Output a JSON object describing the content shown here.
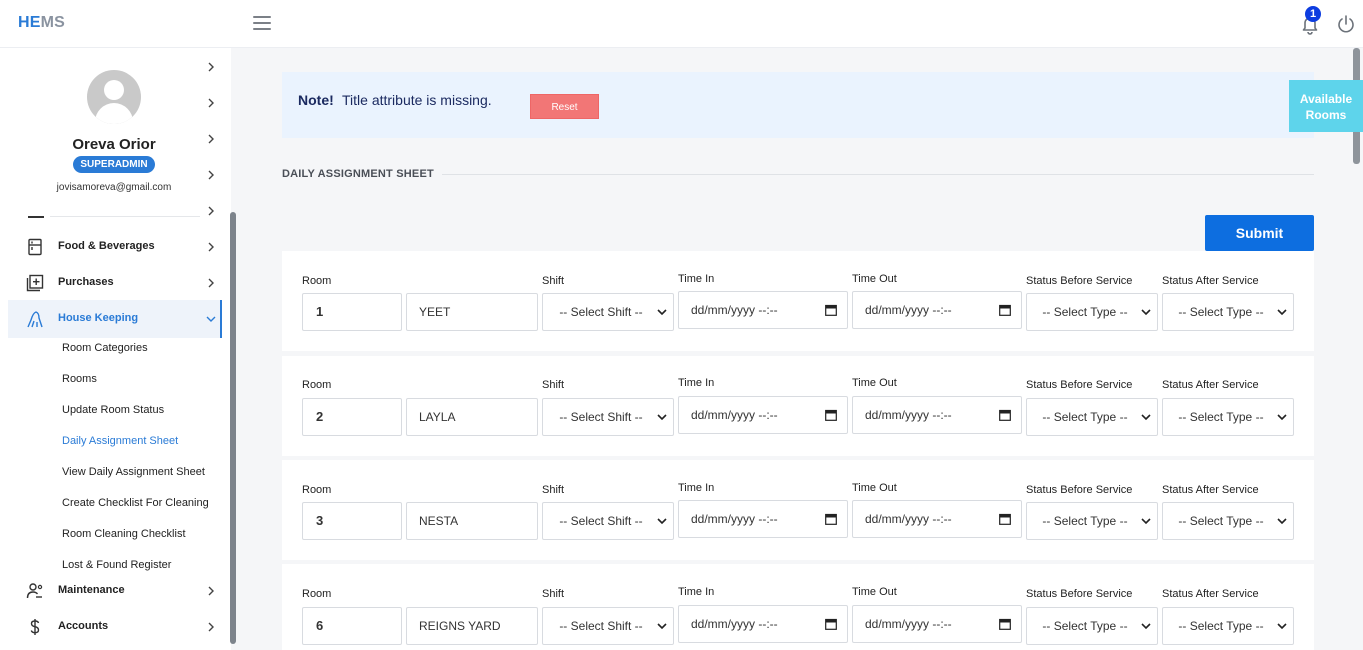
{
  "header": {
    "logo_part1": "HE",
    "logo_part2": "MS",
    "notification_count": "1",
    "icons": [
      "menu-icon",
      "bell-icon",
      "power-icon"
    ]
  },
  "sidebar": {
    "user_name": "Oreva Orior",
    "role": "SUPERADMIN",
    "email": "jovisamoreva@gmail.com",
    "nav": [
      {
        "label": "Food & Beverages",
        "icon": "food-icon"
      },
      {
        "label": "Purchases",
        "icon": "purchases-icon"
      },
      {
        "label": "House Keeping",
        "icon": "housekeeping-icon"
      },
      {
        "label": "Maintenance",
        "icon": "maintenance-icon"
      },
      {
        "label": "Accounts",
        "icon": "dollar-icon"
      }
    ],
    "sub_items": [
      "Room Categories",
      "Rooms",
      "Update Room Status",
      "Daily Assignment Sheet",
      "View Daily Assignment Sheet",
      "Create Checklist For Cleaning",
      "Room Cleaning Checklist",
      "Lost & Found Register"
    ]
  },
  "note": {
    "title": "Note!",
    "text": "Title attribute is missing.",
    "reset_label": "Reset"
  },
  "available_rooms_label": "Available Rooms",
  "section_title": "DAILY ASSIGNMENT SHEET",
  "submit_label": "Submit",
  "labels": {
    "room": "Room",
    "shift": "Shift",
    "time_in": "Time In",
    "time_out": "Time Out",
    "status_before": "Status Before Service",
    "status_after": "Status After Service"
  },
  "placeholders": {
    "shift": "-- Select Shift --",
    "datetime": "dd/mm/yyyy --:--",
    "type": "-- Select Type --"
  },
  "rows": [
    {
      "number": "1",
      "name": "YEET"
    },
    {
      "number": "2",
      "name": "LAYLA"
    },
    {
      "number": "3",
      "name": "NESTA"
    },
    {
      "number": "6",
      "name": "REIGNS YARD"
    }
  ],
  "colors": {
    "accent": "#2a7bd6",
    "submit": "#0d6ee0",
    "reset": "#f27676",
    "available": "#5ed4eb",
    "note_bg": "#eaf3fe"
  }
}
